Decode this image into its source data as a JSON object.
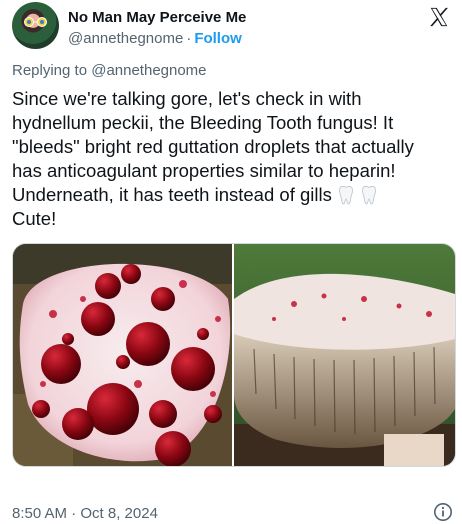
{
  "author": {
    "name": "No Man May Perceive Me",
    "handle": "@annethegnome",
    "separator": "·",
    "follow_label": "Follow"
  },
  "reply": {
    "text": "Replying to @annethegnome"
  },
  "tweet": {
    "text": "Since we're talking gore, let's check in with\nhydnellum peckii, the Bleeding Tooth fungus! It\n\"bleeds\" bright red guttation droplets that actually\nhas anticoagulant properties similar to heparin!\nUnderneath, it has teeth instead of gills",
    "line_two": "Cute!",
    "emojis": [
      "tooth-emoji",
      "tooth-emoji"
    ]
  },
  "media": {
    "images": [
      {
        "name": "bleeding-tooth-fungus-top-photo"
      },
      {
        "name": "bleeding-tooth-fungus-underside-photo"
      }
    ]
  },
  "footer": {
    "timestamp": "8:50 AM · Oct 8, 2024"
  },
  "icons": {
    "brand": "x-logo-icon",
    "info": "info-icon"
  },
  "colors": {
    "accent": "#1d9bf0",
    "secondary_text": "#536471",
    "text": "#0f1419",
    "border": "#cfd9de"
  }
}
